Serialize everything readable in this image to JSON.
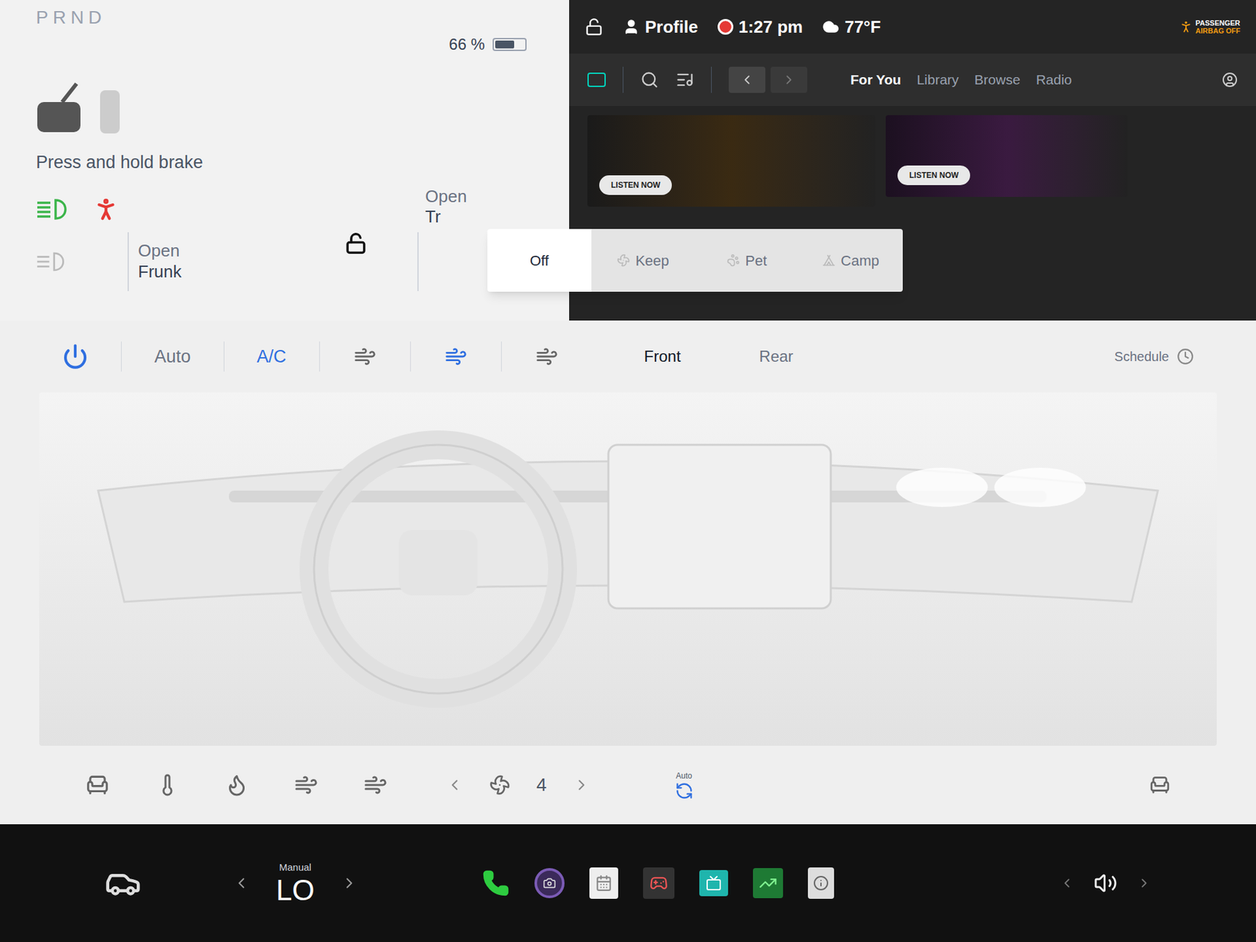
{
  "drive": {
    "gears": "PRND",
    "battery": "66 %",
    "battery_level": 0.66,
    "hint": "Press and hold brake"
  },
  "controls": [
    {
      "line1": "Open",
      "line2": "Frunk"
    },
    {
      "line1": "Open",
      "line2": "Tr"
    }
  ],
  "climate_keeper": [
    {
      "label": "Off",
      "selected": true
    },
    {
      "label": "Keep",
      "selected": false
    },
    {
      "label": "Pet",
      "selected": false
    },
    {
      "label": "Camp",
      "selected": false
    }
  ],
  "status_bar": {
    "profile": "Profile",
    "recording": true,
    "time": "1:27 pm",
    "temperature": "77°F",
    "airbag": [
      "PASSENGER",
      "AIRBAG OFF"
    ]
  },
  "media": {
    "tabs": [
      {
        "label": "For You",
        "selected": true
      },
      {
        "label": "Library",
        "selected": false
      },
      {
        "label": "Browse",
        "selected": false
      },
      {
        "label": "Radio",
        "selected": false
      }
    ],
    "cards": [
      {
        "button": "LISTEN NOW"
      },
      {
        "button": "LISTEN NOW"
      }
    ]
  },
  "climate": {
    "power": true,
    "auto": {
      "label": "Auto",
      "on": false
    },
    "ac": {
      "label": "A/C",
      "on": true
    },
    "airflow": [
      {
        "selected": false
      },
      {
        "selected": true
      },
      {
        "selected": false
      }
    ],
    "zones": [
      {
        "label": "Front",
        "selected": true
      },
      {
        "label": "Rear",
        "selected": false
      }
    ],
    "schedule": "Schedule",
    "fan_speed": "4",
    "recirc_label": "Auto"
  },
  "dock": {
    "temp_mode": "Manual",
    "temperature": "LO"
  }
}
